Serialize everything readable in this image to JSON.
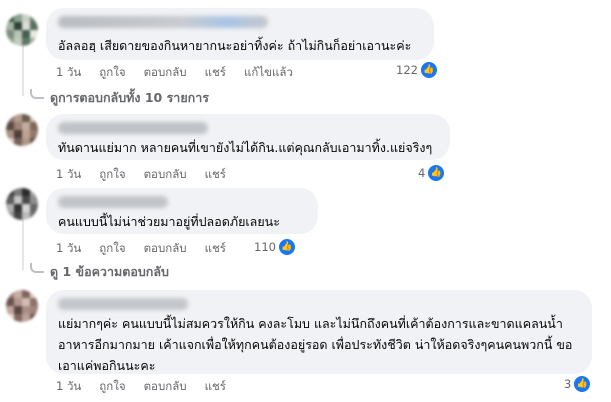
{
  "comments": [
    {
      "text": "อัลลอฮฺ เสียดายของกินหายากนะอย่าทิ้งค่ะ ถ้าไม่กินก็อย่าเอานะค่ะ",
      "time": "1 วัน",
      "like_label": "ถูกใจ",
      "reply_label": "ตอบกลับ",
      "share_label": "แชร์",
      "edited_label": "แก้ไขแล้ว",
      "reactions": "122"
    },
    {
      "text": "ทันดานแย่มาก หลายคนที่เขายังไม่ได้กิน.แต่คุณกลับเอามาทิ้ง.แย่จริงๆ",
      "time": "1 วัน",
      "like_label": "ถูกใจ",
      "reply_label": "ตอบกลับ",
      "share_label": "แชร์",
      "reactions": "4"
    },
    {
      "text": "คนแบบนี้ไม่น่าช่วยมาอยู่ที่ปลอดภัยเลยนะ",
      "time": "1 วัน",
      "like_label": "ถูกใจ",
      "reply_label": "ตอบกลับ",
      "share_label": "แชร์",
      "reactions": "110"
    },
    {
      "text": "แย่มากๆค่ะ คนแบบนี้ไม่สมควรให้กิน คงละโมบ และไม่นึกถึงคนที่เค้าต้องการและขาดแคลนน้ำ อาหารอีกมากมาย เค้าแจกเพื่อให้ทุกคนต้องอยู่รอด เพื่อประทังชีวิต น่าให้อดจริงๆคนคนพวกนี้ ขอเอาแค่พอกินนะคะ",
      "time": "1 วัน",
      "like_label": "ถูกใจ",
      "reply_label": "ตอบกลับ",
      "share_label": "แชร์",
      "reactions": "3"
    }
  ],
  "view_replies_1": "ดูการตอบกลับทั้ง 10 รายการ",
  "view_replies_2": "ดู 1 ข้อความตอบกลับ",
  "colors": {
    "bubble": "#f0f2f5",
    "like_blue": "#1877f2",
    "meta_gray": "#65676b"
  },
  "icons": {
    "reaction": "like-thumb-icon"
  }
}
